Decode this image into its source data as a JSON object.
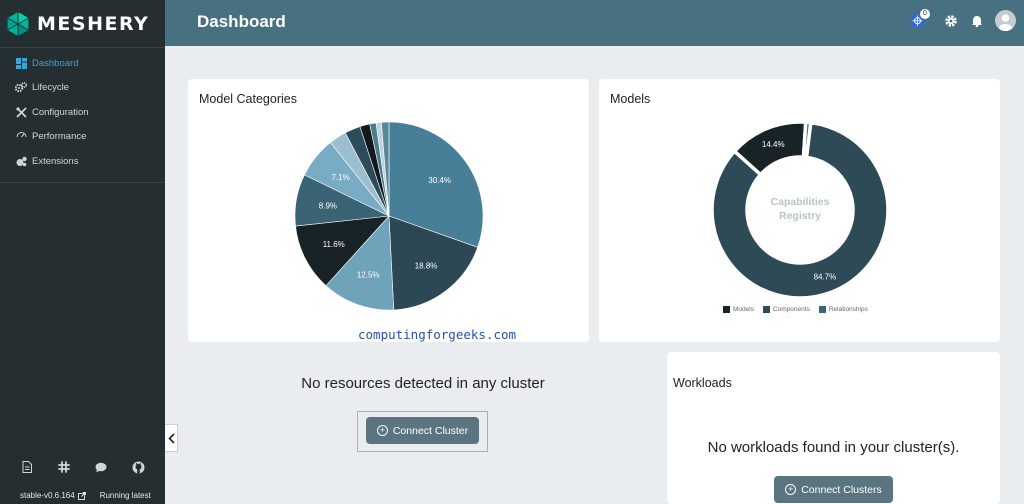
{
  "brand": {
    "name": "MESHERY"
  },
  "sidebar": {
    "items": [
      {
        "label": "Dashboard",
        "icon": "dashboard-icon",
        "active": true
      },
      {
        "label": "Lifecycle",
        "icon": "gears-icon",
        "active": false
      },
      {
        "label": "Configuration",
        "icon": "tools-icon",
        "active": false
      },
      {
        "label": "Performance",
        "icon": "gauge-icon",
        "active": false
      },
      {
        "label": "Extensions",
        "icon": "puzzle-icon",
        "active": false
      }
    ],
    "footer_icons": [
      "document-icon",
      "slack-icon",
      "chat-icon",
      "github-icon"
    ],
    "version": "stable-v0.6.164",
    "status": "Running latest"
  },
  "header": {
    "title": "Dashboard",
    "notification_count": "0"
  },
  "model_categories": {
    "title": "Model Categories",
    "watermark": "computingforgeeks.com"
  },
  "models": {
    "title": "Models",
    "center_text_1": "Capabilities",
    "center_text_2": "Registry",
    "legend": [
      "Models",
      "Components",
      "Relationships"
    ]
  },
  "cluster": {
    "message": "No resources detected in any cluster",
    "button_label": "Connect Cluster"
  },
  "workloads": {
    "title": "Workloads",
    "message": "No workloads found in your cluster(s).",
    "button_label": "Connect Clusters"
  },
  "colors": {
    "header_bg": "#477080",
    "sidebar_bg": "#252e31",
    "active_nav": "#3aa6d8",
    "button_bg": "#5b7580",
    "focus": "#f5a623"
  },
  "chart_data": [
    {
      "type": "pie",
      "title": "Model Categories",
      "slices": [
        {
          "label": "30.4%",
          "value": 30.4,
          "color": "#477f98"
        },
        {
          "label": "18.8%",
          "value": 18.8,
          "color": "#2c4855"
        },
        {
          "label": "12.5%",
          "value": 12.5,
          "color": "#6ea3ba"
        },
        {
          "label": "11.6%",
          "value": 11.6,
          "color": "#172326"
        },
        {
          "label": "8.9%",
          "value": 8.9,
          "color": "#3a6373"
        },
        {
          "label": "7.1%",
          "value": 7.1,
          "color": "#78acc4"
        },
        {
          "label": "",
          "value": 3.0,
          "color": "#9bbfd0"
        },
        {
          "label": "",
          "value": 2.7,
          "color": "#2d4c59"
        },
        {
          "label": "",
          "value": 1.7,
          "color": "#111a1d"
        },
        {
          "label": "",
          "value": 1.1,
          "color": "#4f7c8c"
        },
        {
          "label": "",
          "value": 0.9,
          "color": "#bcd4de"
        },
        {
          "label": "",
          "value": 1.3,
          "color": "#5a8898"
        }
      ]
    },
    {
      "type": "pie",
      "title": "Models",
      "donut": true,
      "slices": [
        {
          "label": "84.7%",
          "value": 84.7,
          "color": "#2d4a56",
          "legend": "Components"
        },
        {
          "label": "14.4%",
          "value": 14.4,
          "color": "#172326",
          "legend": "Models"
        },
        {
          "label": "",
          "value": 0.9,
          "color": "#3a6575",
          "legend": "Relationships"
        }
      ],
      "legend": [
        {
          "name": "Models",
          "color": "#172326"
        },
        {
          "name": "Components",
          "color": "#2d4a56"
        },
        {
          "name": "Relationships",
          "color": "#3a6575"
        }
      ]
    }
  ]
}
